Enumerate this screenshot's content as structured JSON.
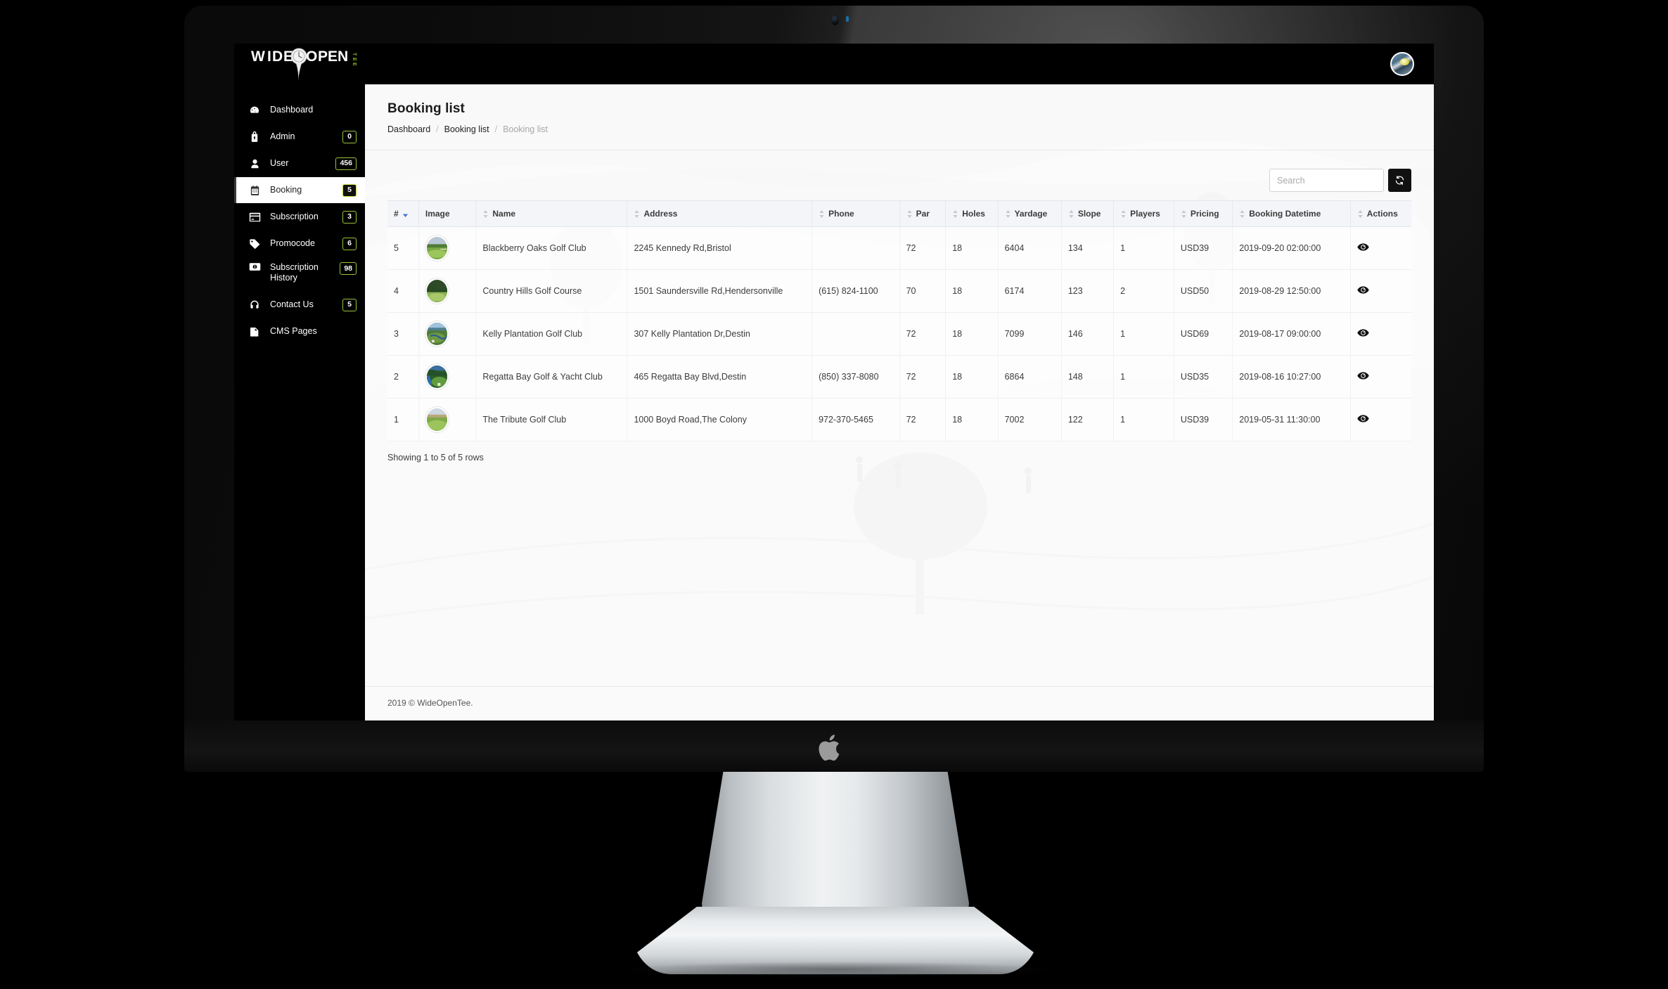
{
  "brand": {
    "name": "WIDE OPEN",
    "suffix": "TEE"
  },
  "header": {
    "avatar_icon": "user-avatar"
  },
  "sidebar": {
    "items": [
      {
        "label": "Dashboard",
        "badge": null,
        "icon": "dashboard-icon",
        "active": false
      },
      {
        "label": "Admin",
        "badge": "0",
        "icon": "admin-lock-icon",
        "active": false
      },
      {
        "label": "User",
        "badge": "456",
        "icon": "user-icon",
        "active": false
      },
      {
        "label": "Booking",
        "badge": "5",
        "icon": "calendar-icon",
        "active": true
      },
      {
        "label": "Subscription",
        "badge": "3",
        "icon": "credit-card-icon",
        "active": false
      },
      {
        "label": "Promocode",
        "badge": "6",
        "icon": "tag-icon",
        "active": false
      },
      {
        "label": "Subscription History",
        "badge": "98",
        "icon": "money-icon",
        "active": false
      },
      {
        "label": "Contact Us",
        "badge": "5",
        "icon": "headset-icon",
        "active": false
      },
      {
        "label": "CMS Pages",
        "badge": null,
        "icon": "pages-icon",
        "active": false
      }
    ]
  },
  "page": {
    "title": "Booking list",
    "breadcrumb": {
      "root": "Dashboard",
      "mid": "Booking list",
      "current": "Booking list"
    }
  },
  "toolbar": {
    "search_placeholder": "Search",
    "search_value": "",
    "refresh_icon": "refresh-icon",
    "refresh_label": "Refresh"
  },
  "table": {
    "columns": [
      {
        "key": "num",
        "label": "#",
        "sortable": true,
        "sorted": "desc"
      },
      {
        "key": "image",
        "label": "Image",
        "sortable": false,
        "sorted": null
      },
      {
        "key": "name",
        "label": "Name",
        "sortable": true,
        "sorted": null
      },
      {
        "key": "address",
        "label": "Address",
        "sortable": true,
        "sorted": null
      },
      {
        "key": "phone",
        "label": "Phone",
        "sortable": true,
        "sorted": null
      },
      {
        "key": "par",
        "label": "Par",
        "sortable": true,
        "sorted": null
      },
      {
        "key": "holes",
        "label": "Holes",
        "sortable": true,
        "sorted": null
      },
      {
        "key": "yardage",
        "label": "Yardage",
        "sortable": true,
        "sorted": null
      },
      {
        "key": "slope",
        "label": "Slope",
        "sortable": true,
        "sorted": null
      },
      {
        "key": "players",
        "label": "Players",
        "sortable": true,
        "sorted": null
      },
      {
        "key": "pricing",
        "label": "Pricing",
        "sortable": true,
        "sorted": null
      },
      {
        "key": "booking",
        "label": "Booking Datetime",
        "sortable": true,
        "sorted": null
      },
      {
        "key": "actions",
        "label": "Actions",
        "sortable": false,
        "sorted": null
      }
    ],
    "rows": [
      {
        "num": "5",
        "image_icon": "course-thumbnail",
        "name": "Blackberry Oaks Golf Club",
        "address": "2245 Kennedy Rd,Bristol",
        "phone": "",
        "par": "72",
        "holes": "18",
        "yardage": "6404",
        "slope": "134",
        "players": "1",
        "pricing": "USD39",
        "booking": "2019-09-20 02:00:00",
        "action_icon": "eye-icon"
      },
      {
        "num": "4",
        "image_icon": "course-thumbnail",
        "name": "Country Hills Golf Course",
        "address": "1501 Saundersville Rd,Hendersonville",
        "phone": "(615) 824-1100",
        "par": "70",
        "holes": "18",
        "yardage": "6174",
        "slope": "123",
        "players": "2",
        "pricing": "USD50",
        "booking": "2019-08-29 12:50:00",
        "action_icon": "eye-icon"
      },
      {
        "num": "3",
        "image_icon": "course-thumbnail",
        "name": "Kelly Plantation Golf Club",
        "address": "307 Kelly Plantation Dr,Destin",
        "phone": "",
        "par": "72",
        "holes": "18",
        "yardage": "7099",
        "slope": "146",
        "players": "1",
        "pricing": "USD69",
        "booking": "2019-08-17 09:00:00",
        "action_icon": "eye-icon"
      },
      {
        "num": "2",
        "image_icon": "course-thumbnail",
        "name": "Regatta Bay Golf & Yacht Club",
        "address": "465 Regatta Bay Blvd,Destin",
        "phone": "(850) 337-8080",
        "par": "72",
        "holes": "18",
        "yardage": "6864",
        "slope": "148",
        "players": "1",
        "pricing": "USD35",
        "booking": "2019-08-16 10:27:00",
        "action_icon": "eye-icon"
      },
      {
        "num": "1",
        "image_icon": "course-thumbnail",
        "name": "The Tribute Golf Club",
        "address": "1000 Boyd Road,The Colony",
        "phone": "972-370-5465",
        "par": "72",
        "holes": "18",
        "yardage": "7002",
        "slope": "122",
        "players": "1",
        "pricing": "USD39",
        "booking": "2019-05-31 11:30:00",
        "action_icon": "eye-icon"
      }
    ],
    "summary": "Showing 1 to 5 of 5 rows"
  },
  "footer": {
    "copyright": "2019 © WideOpenTee."
  },
  "colors": {
    "sidebar_bg": "#000000",
    "badge_border": "#9ac33a",
    "topbar_bg": "#000000",
    "table_head_bg": "#f3f5f8",
    "sort_active": "#4a6fd4"
  },
  "device": {
    "brand_logo": "apple-logo"
  }
}
